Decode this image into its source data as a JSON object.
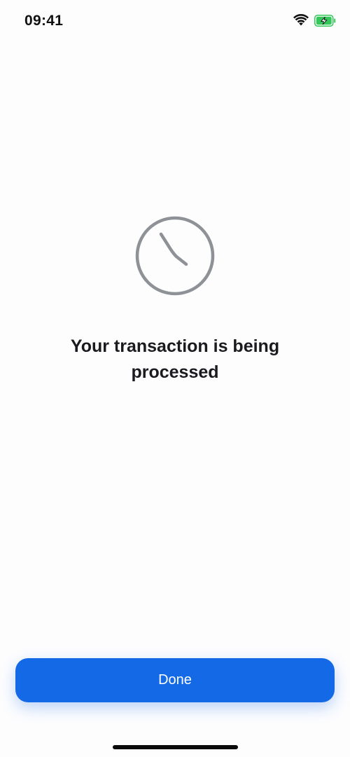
{
  "status_bar": {
    "time": "09:41",
    "wifi_icon": "wifi-icon",
    "battery_icon": "battery-charging-icon",
    "battery_color": "#34C759"
  },
  "main": {
    "icon": "clock-icon",
    "icon_color": "#8E9196",
    "message": "Your transaction is being processed"
  },
  "actions": {
    "done_label": "Done",
    "accent_color": "#1469E6"
  }
}
